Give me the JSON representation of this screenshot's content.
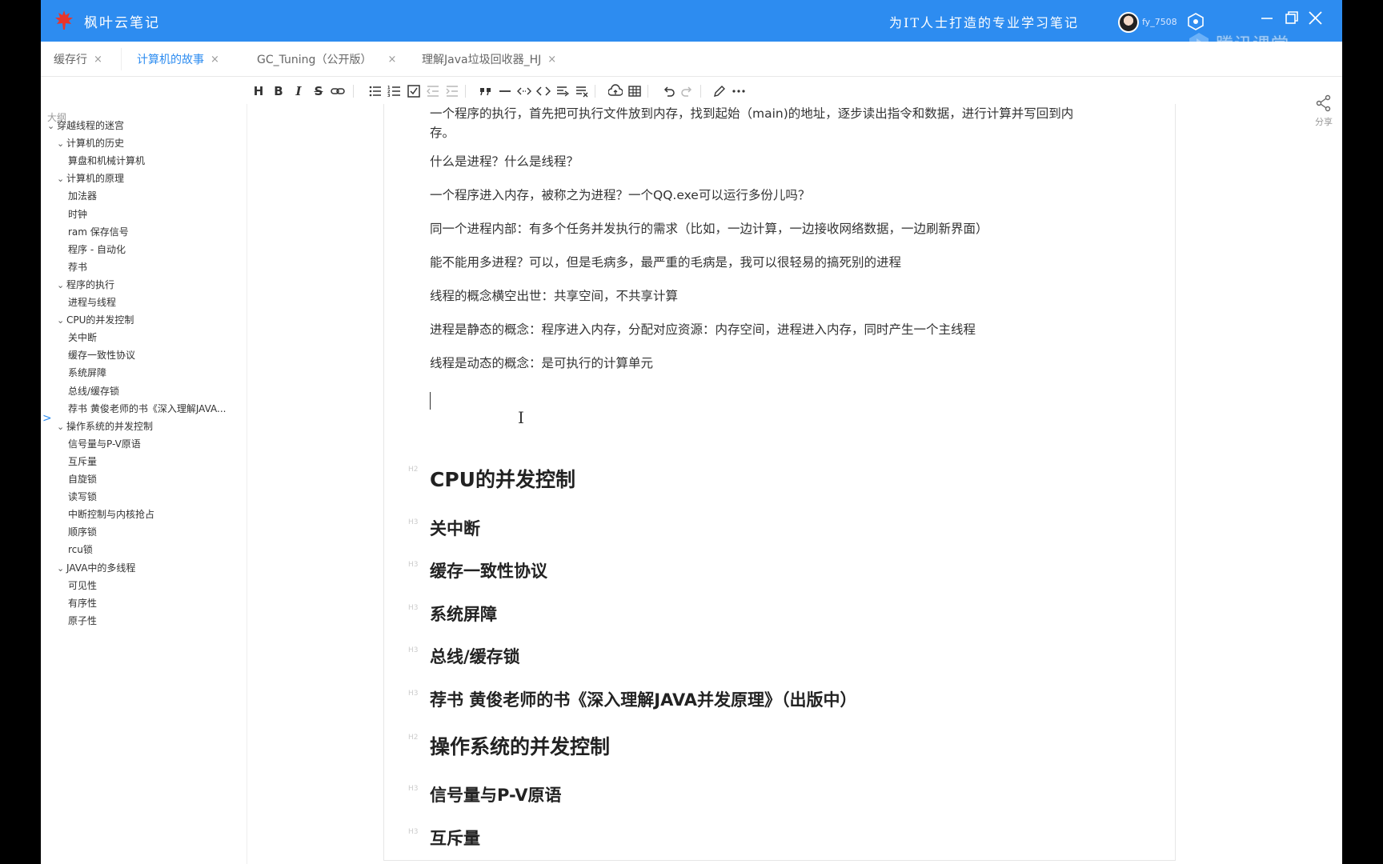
{
  "titlebar": {
    "app_name": "枫叶云笔记",
    "slogan": "为IT人士打造的专业学习笔记",
    "username": "fy_7508",
    "watermark": "腾讯课堂",
    "brand_color": "#2d8cf0"
  },
  "tabs": [
    {
      "label": "缓存行",
      "active": false
    },
    {
      "label": "计算机的故事",
      "active": true
    },
    {
      "label": "GC_Tuning（公开版）",
      "active": false
    },
    {
      "label": "理解Java垃圾回收器_HJ",
      "active": false
    }
  ],
  "tab_close_glyph": "×",
  "sidebar": {
    "title": "大纲",
    "items": [
      {
        "label": "穿越线程的迷宫",
        "level": 0,
        "expandable": true
      },
      {
        "label": "计算机的历史",
        "level": 1,
        "expandable": true
      },
      {
        "label": "算盘和机械计算机",
        "level": 2,
        "expandable": false
      },
      {
        "label": "计算机的原理",
        "level": 1,
        "expandable": true
      },
      {
        "label": "加法器",
        "level": 2,
        "expandable": false
      },
      {
        "label": "时钟",
        "level": 2,
        "expandable": false
      },
      {
        "label": "ram 保存信号",
        "level": 2,
        "expandable": false
      },
      {
        "label": "程序 - 自动化",
        "level": 2,
        "expandable": false
      },
      {
        "label": "荐书",
        "level": 2,
        "expandable": false
      },
      {
        "label": "程序的执行",
        "level": 1,
        "expandable": true
      },
      {
        "label": "进程与线程",
        "level": 2,
        "expandable": false
      },
      {
        "label": "CPU的并发控制",
        "level": 1,
        "expandable": true
      },
      {
        "label": "关中断",
        "level": 2,
        "expandable": false
      },
      {
        "label": "缓存一致性协议",
        "level": 2,
        "expandable": false
      },
      {
        "label": "系统屏障",
        "level": 2,
        "expandable": false
      },
      {
        "label": "总线/缓存锁",
        "level": 2,
        "expandable": false
      },
      {
        "label": "荐书 黄俊老师的书《深入理解JAVA...",
        "level": 2,
        "expandable": false
      },
      {
        "label": "操作系统的并发控制",
        "level": 1,
        "expandable": true
      },
      {
        "label": "信号量与P-V原语",
        "level": 2,
        "expandable": false
      },
      {
        "label": "互斥量",
        "level": 2,
        "expandable": false
      },
      {
        "label": "自旋锁",
        "level": 2,
        "expandable": false
      },
      {
        "label": "读写锁",
        "level": 2,
        "expandable": false
      },
      {
        "label": "中断控制与内核抢占",
        "level": 2,
        "expandable": false
      },
      {
        "label": "顺序锁",
        "level": 2,
        "expandable": false
      },
      {
        "label": "rcu锁",
        "level": 2,
        "expandable": false
      },
      {
        "label": "JAVA中的多线程",
        "level": 1,
        "expandable": true
      },
      {
        "label": "可见性",
        "level": 2,
        "expandable": false
      },
      {
        "label": "有序性",
        "level": 2,
        "expandable": false
      },
      {
        "label": "原子性",
        "level": 2,
        "expandable": false
      }
    ]
  },
  "editor": {
    "paragraphs": [
      "一个程序的执行，首先把可执行文件放到内存，找到起始（main)的地址，逐步读出指令和数据，进行计算并写回到内",
      "存。",
      "什么是进程？什么是线程？",
      "一个程序进入内存，被称之为进程？一个QQ.exe可以运行多份儿吗？",
      "同一个进程内部：有多个任务并发执行的需求（比如，一边计算，一边接收网络数据，一边刷新界面）",
      "能不能用多进程？可以，但是毛病多，最严重的毛病是，我可以很轻易的搞死别的进程",
      "线程的概念横空出世：共享空间，不共享计算",
      "进程是静态的概念：程序进入内存，分配对应资源：内存空间，进程进入内存，同时产生一个主线程",
      "线程是动态的概念：是可执行的计算单元"
    ],
    "headings": [
      {
        "text": "CPU的并发控制",
        "level": "H2"
      },
      {
        "text": "关中断",
        "level": "H3"
      },
      {
        "text": "缓存一致性协议",
        "level": "H3"
      },
      {
        "text": "系统屏障",
        "level": "H3"
      },
      {
        "text": "总线/缓存锁",
        "level": "H3"
      },
      {
        "text": "荐书 黄俊老师的书《深入理解JAVA并发原理》（出版中）",
        "level": "H3"
      },
      {
        "text": "操作系统的并发控制",
        "level": "H2"
      },
      {
        "text": "信号量与P-V原语",
        "level": "H3"
      },
      {
        "text": "互斥量",
        "level": "H3"
      }
    ]
  },
  "rail": {
    "share_label": "分享"
  }
}
